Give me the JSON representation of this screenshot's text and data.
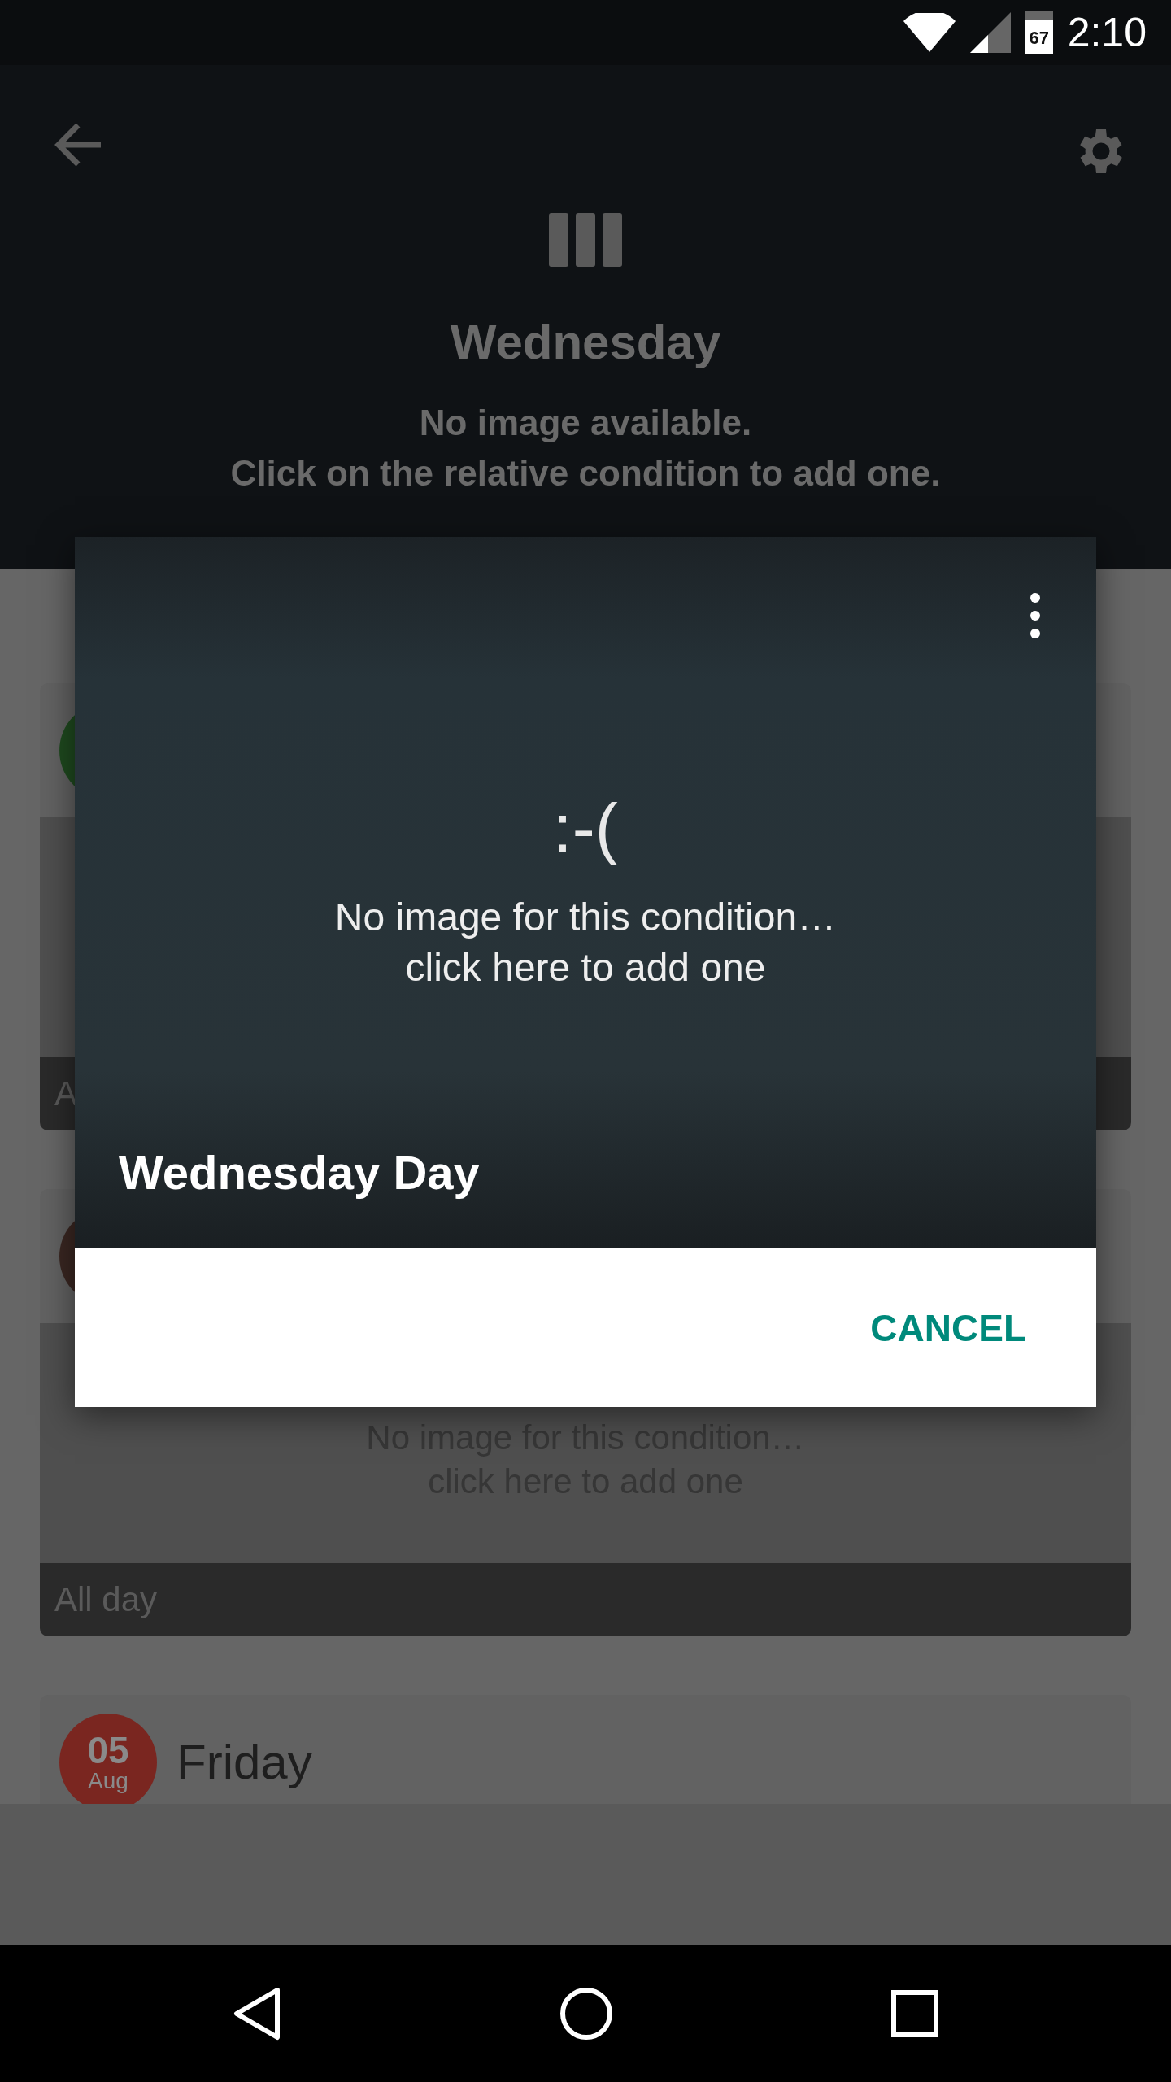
{
  "status_bar": {
    "battery": "67",
    "time": "2:10"
  },
  "header": {
    "title": "Wednesday",
    "message": [
      "No image available.",
      "Click on the relative condition to add one."
    ]
  },
  "cards": [
    {
      "color": "#1f4a1f",
      "footer": "A"
    },
    {
      "color": "#3a2722",
      "image_message": [
        "No image for this condition…",
        "click here to add one"
      ],
      "footer": "All day"
    },
    {
      "color": "#7a2620",
      "day": "05",
      "month": "Aug",
      "weekday": "Friday"
    }
  ],
  "dialog": {
    "sad_face": ":-(",
    "message": [
      "No image for this condition…",
      "click here to add one"
    ],
    "title": "Wednesday Day",
    "buttons": [
      "CANCEL"
    ]
  }
}
